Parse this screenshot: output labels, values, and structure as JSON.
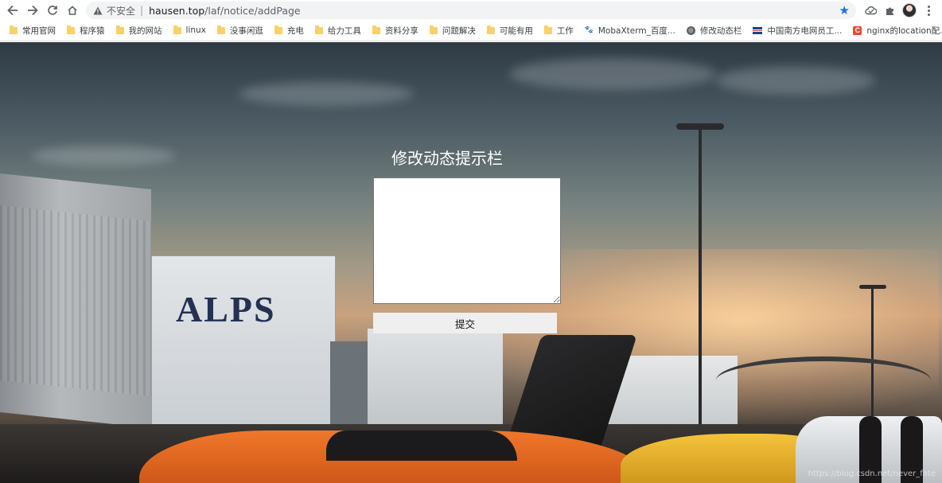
{
  "browser": {
    "security_label": "不安全",
    "separator": "|",
    "url_host": "hausen.top",
    "url_path": "/laf/notice/addPage",
    "icons": [
      "back-icon",
      "forward-icon",
      "reload-icon",
      "home-icon",
      "warning-icon",
      "star-icon",
      "extension-icon",
      "puzzle-icon",
      "avatar",
      "menu-icon"
    ]
  },
  "bookmarks": [
    {
      "label": "常用官网",
      "icon": "folder"
    },
    {
      "label": "程序猿",
      "icon": "folder"
    },
    {
      "label": "我的网站",
      "icon": "folder"
    },
    {
      "label": "linux",
      "icon": "folder"
    },
    {
      "label": "没事闲逛",
      "icon": "folder"
    },
    {
      "label": "充电",
      "icon": "folder"
    },
    {
      "label": "给力工具",
      "icon": "folder"
    },
    {
      "label": "资料分享",
      "icon": "folder"
    },
    {
      "label": "问题解决",
      "icon": "folder"
    },
    {
      "label": "可能有用",
      "icon": "folder"
    },
    {
      "label": "工作",
      "icon": "folder"
    },
    {
      "label": "MobaXterm_百度...",
      "icon": "baidu-paw"
    },
    {
      "label": "修改动态栏",
      "icon": "globe"
    },
    {
      "label": "中国南方电网员工...",
      "icon": "flag"
    },
    {
      "label": "nginx的location配...",
      "icon": "csdn-c"
    }
  ],
  "form": {
    "title": "修改动态提示栏",
    "textarea_value": "",
    "submit_label": "提交"
  },
  "background": {
    "truck_text_1": "ALPS",
    "watermark": "https://blog.csdn.net/never_fate"
  },
  "colors": {
    "star": "#1a73e8",
    "folder": "#f9d16b",
    "title_text": "#ffffff",
    "button_bg": "#efefef"
  }
}
